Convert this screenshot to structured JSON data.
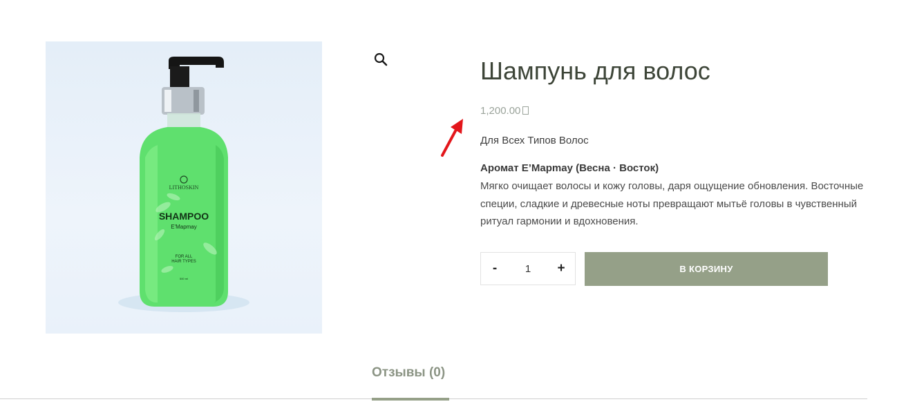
{
  "product": {
    "title": "Шампунь для волос",
    "price": "1,200.00",
    "subtitle": "Для Всех Типов Волос",
    "aroma": "Аромат E’Mapmay (Весна · Восток)",
    "description": "Мягко очищает волосы и кожу головы, даря ощущение обновления. Восточные специи, сладкие и древесные ноты превращают мытьё головы в чувственный ритуал гармонии и вдохновения."
  },
  "image": {
    "bottle_brand": "LITHOSKIN",
    "bottle_title": "SHAMPOO",
    "bottle_scent": "E'Mapmay",
    "bottle_line1": "FOR ALL",
    "bottle_line2": "HAIR TYPES",
    "bottle_volume": "500 ml"
  },
  "cart": {
    "minus_label": "-",
    "plus_label": "+",
    "quantity": "1",
    "add_to_cart_label": "В КОРЗИНУ"
  },
  "tabs": [
    {
      "label": "Отзывы (0)",
      "active": true
    }
  ],
  "icons": {
    "zoom": "magnifier-icon",
    "annotation": "red-arrow-icon"
  },
  "colors": {
    "accent": "#95a088",
    "title": "#3d4538",
    "price": "#9aa39a",
    "annotation": "#e3161b",
    "bottle": "#5fe06e"
  }
}
